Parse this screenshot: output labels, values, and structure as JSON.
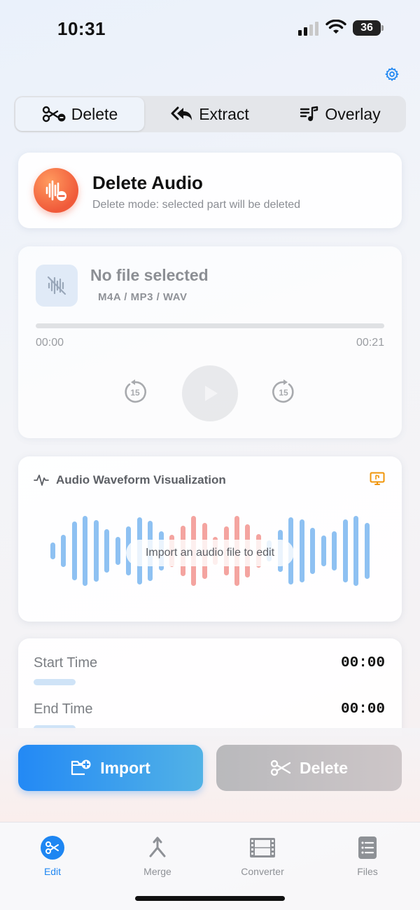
{
  "status_bar": {
    "time": "10:31",
    "battery": "36"
  },
  "colors": {
    "accent": "#1e86f2",
    "mode_icon": "#f05a3a",
    "wave_blue": "#8ec1f2",
    "wave_red": "#f4a4a0",
    "warning": "#f0950a"
  },
  "header": {
    "settings_icon": "gear-icon"
  },
  "segments": [
    {
      "label": "Delete",
      "icon": "scissors-icon",
      "active": true
    },
    {
      "label": "Extract",
      "icon": "reply-all-icon",
      "active": false
    },
    {
      "label": "Overlay",
      "icon": "music-list-icon",
      "active": false
    }
  ],
  "mode_card": {
    "title": "Delete Audio",
    "subtitle": "Delete mode: selected part will be deleted"
  },
  "player": {
    "file_title": "No file selected",
    "formats": "M4A / MP3 / WAV",
    "time_start": "00:00",
    "time_end": "00:21",
    "skip_back_label": "15",
    "skip_forward_label": "15",
    "progress": 0
  },
  "waveform": {
    "title": "Audio Waveform Visualization",
    "placeholder": "Import an audio file to edit"
  },
  "time_range": {
    "start_label": "Start Time",
    "start_value": "00:00",
    "end_label": "End Time",
    "end_value": "00:00"
  },
  "actions": {
    "import_label": "Import",
    "delete_label": "Delete"
  },
  "tabs": [
    {
      "label": "Edit",
      "icon": "scissors-icon",
      "active": true
    },
    {
      "label": "Merge",
      "icon": "merge-icon",
      "active": false
    },
    {
      "label": "Converter",
      "icon": "film-icon",
      "active": false
    },
    {
      "label": "Files",
      "icon": "files-icon",
      "active": false
    }
  ]
}
